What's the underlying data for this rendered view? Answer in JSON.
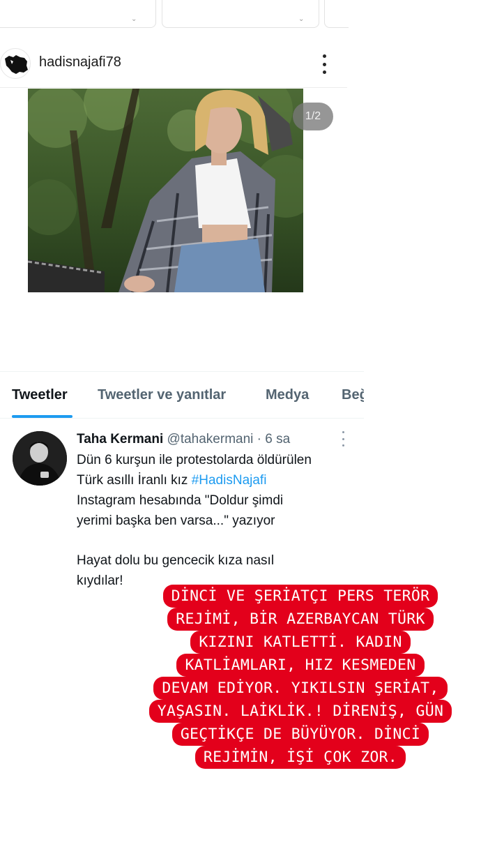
{
  "instagram": {
    "username": "hadisnajafi78",
    "photo_counter": "1/2",
    "top_cards": [
      {
        "chevron": "⌄"
      },
      {
        "chevron": "⌄"
      }
    ]
  },
  "twitter": {
    "tabs": [
      {
        "label": "Tweetler",
        "active": true
      },
      {
        "label": "Tweetler ve yanıtlar",
        "active": false
      },
      {
        "label": "Medya",
        "active": false
      },
      {
        "label": "Beğ",
        "active": false
      }
    ],
    "tweet": {
      "display_name": "Taha Kermani",
      "handle": "@tahakermani",
      "separator": " · ",
      "time": "6 sa",
      "line1": "Dün 6 kurşun ile protestolarda öldürülen",
      "line2_text": "Türk asıllı İranlı kız ",
      "line2_hashtag": "#HadisNajafi",
      "line3": "Instagram hesabında \"Doldur şimdi",
      "line4": "yerimi başka ben varsa...\" yazıyor",
      "line5": "Hayat dolu bu gencecik kıza nasıl",
      "line6": "kıydılar!"
    }
  },
  "story_overlay": {
    "lines": [
      "DİNCİ VE ŞERİATÇI PERS TERÖR",
      "REJİMİ, BİR AZERBAYCAN TÜRK",
      "KIZINI KATLETTİ. KADIN",
      "KATLİAMLARI, HIZ KESMEDEN",
      "DEVAM EDİYOR. YIKILSIN ŞERİAT,",
      "YAŞASIN. LAİKLİK.! DİRENİŞ, GÜN",
      "GEÇTİKÇE DE BÜYÜYOR. DİNCİ",
      "REJİMİN, İŞİ ÇOK ZOR."
    ],
    "background_color": "#e3001b",
    "text_color": "#ffffff"
  },
  "colors": {
    "twitter_blue": "#1d9bf0",
    "muted_text": "#536471"
  }
}
